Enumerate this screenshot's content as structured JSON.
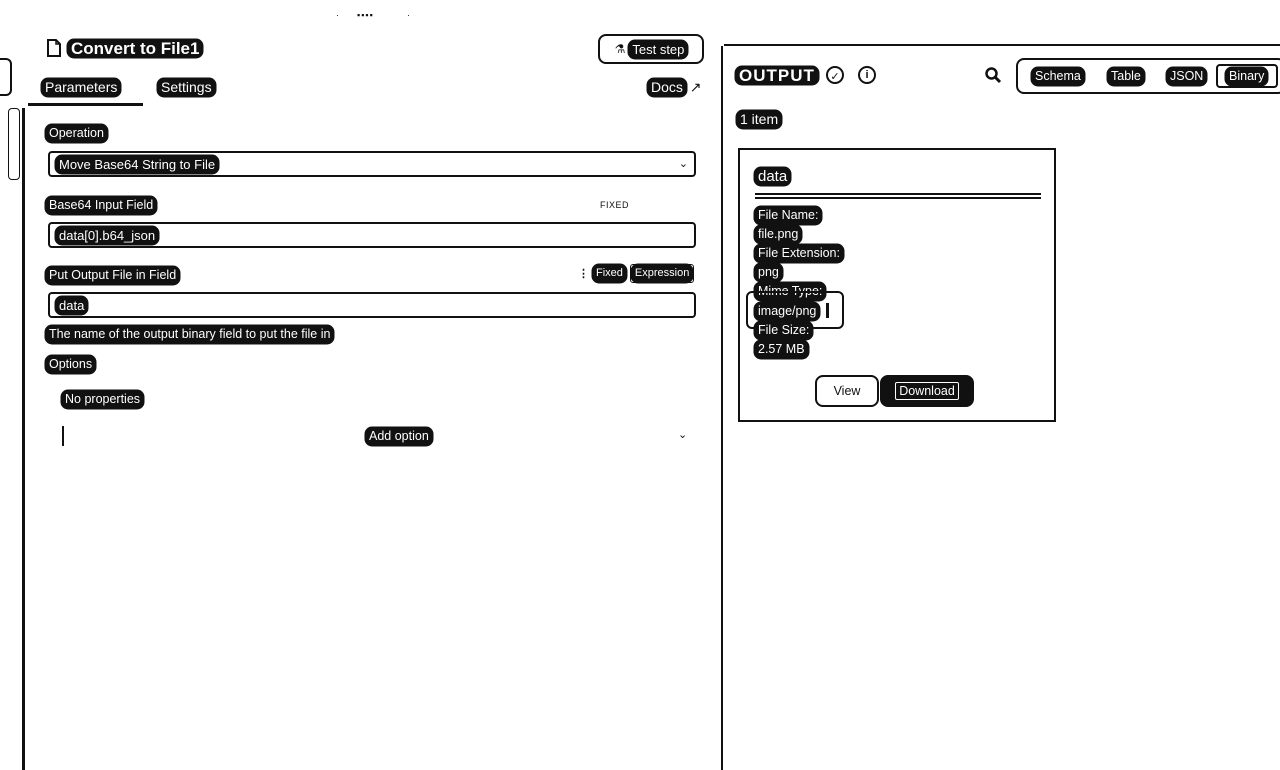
{
  "top_marks": {
    "left": "·",
    "center": "▪▪▪▪",
    "right": "·"
  },
  "node": {
    "icon": "file-convert-icon",
    "title": "Convert to File1",
    "test_step_label": "Test step"
  },
  "tabs": {
    "parameters": "Parameters",
    "settings": "Settings",
    "docs": "Docs"
  },
  "fields": {
    "operation": {
      "label": "Operation",
      "value": "Move Base64 String to File"
    },
    "base64": {
      "label": "Base64 Input Field",
      "value": "data[0].b64_json",
      "hint": "FIXED"
    },
    "output": {
      "label": "Put Output File in Field",
      "value": "data",
      "hint": "The name of the output binary field to put the file in",
      "mode_fixed": "Fixed",
      "mode_expression": "Expression"
    },
    "options": {
      "label": "Options",
      "empty": "No properties",
      "add_label": "Add option"
    }
  },
  "output": {
    "title": "OUTPUT",
    "view_tabs": [
      "Schema",
      "Table",
      "JSON",
      "Binary"
    ],
    "active_view": "Binary",
    "item_count": "1 item",
    "binary": {
      "name": "data",
      "file_name_label": "File Name:",
      "file_name": "file.png",
      "ext_label": "File Extension:",
      "ext": "png",
      "mime_label": "Mime Type:",
      "mime": "image/png",
      "size_label": "File Size:",
      "size": "2.57 MB",
      "view_label": "View",
      "download_label": "Download"
    }
  }
}
